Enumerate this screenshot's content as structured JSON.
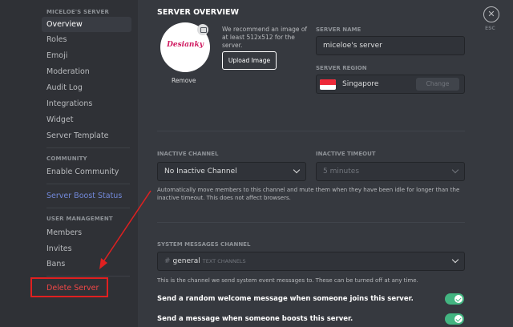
{
  "sidebar": {
    "server_heading": "MICELOE'S SERVER",
    "items": [
      {
        "label": "Overview"
      },
      {
        "label": "Roles"
      },
      {
        "label": "Emoji"
      },
      {
        "label": "Moderation"
      },
      {
        "label": "Audit Log"
      },
      {
        "label": "Integrations"
      },
      {
        "label": "Widget"
      },
      {
        "label": "Server Template"
      }
    ],
    "community_heading": "COMMUNITY",
    "community_items": [
      {
        "label": "Enable Community"
      }
    ],
    "boost_label": "Server Boost Status",
    "user_mgmt_heading": "USER MANAGEMENT",
    "user_items": [
      {
        "label": "Members"
      },
      {
        "label": "Invites"
      },
      {
        "label": "Bans"
      }
    ],
    "delete_label": "Delete Server"
  },
  "overview": {
    "title": "SERVER OVERVIEW",
    "icon_text": "Desianky",
    "remove_label": "Remove",
    "recommend_text": "We recommend an image of at least 512x512 for the server.",
    "upload_label": "Upload Image",
    "server_name_label": "SERVER NAME",
    "server_name_value": "miceloe's server",
    "server_region_label": "SERVER REGION",
    "server_region_value": "Singapore",
    "change_label": "Change"
  },
  "inactive": {
    "channel_label": "INACTIVE CHANNEL",
    "channel_value": "No Inactive Channel",
    "timeout_label": "INACTIVE TIMEOUT",
    "timeout_value": "5 minutes",
    "help": "Automatically move members to this channel and mute them when they have been idle for longer than the inactive timeout. This does not affect browsers."
  },
  "system": {
    "channel_label": "SYSTEM MESSAGES CHANNEL",
    "channel_hash": "#",
    "channel_value": "general",
    "channel_tag": "TEXT CHANNELS",
    "help": "This is the channel we send system event messages to. These can be turned off at any time.",
    "toggle1_label": "Send a random welcome message when someone joins this server.",
    "toggle2_label": "Send a message when someone boosts this server."
  },
  "close": {
    "symbol": "✕",
    "label": "ESC"
  },
  "colors": {
    "accent": "#7289da",
    "danger": "#f04747",
    "toggle_on": "#43b581",
    "annotation": "#e02020"
  }
}
